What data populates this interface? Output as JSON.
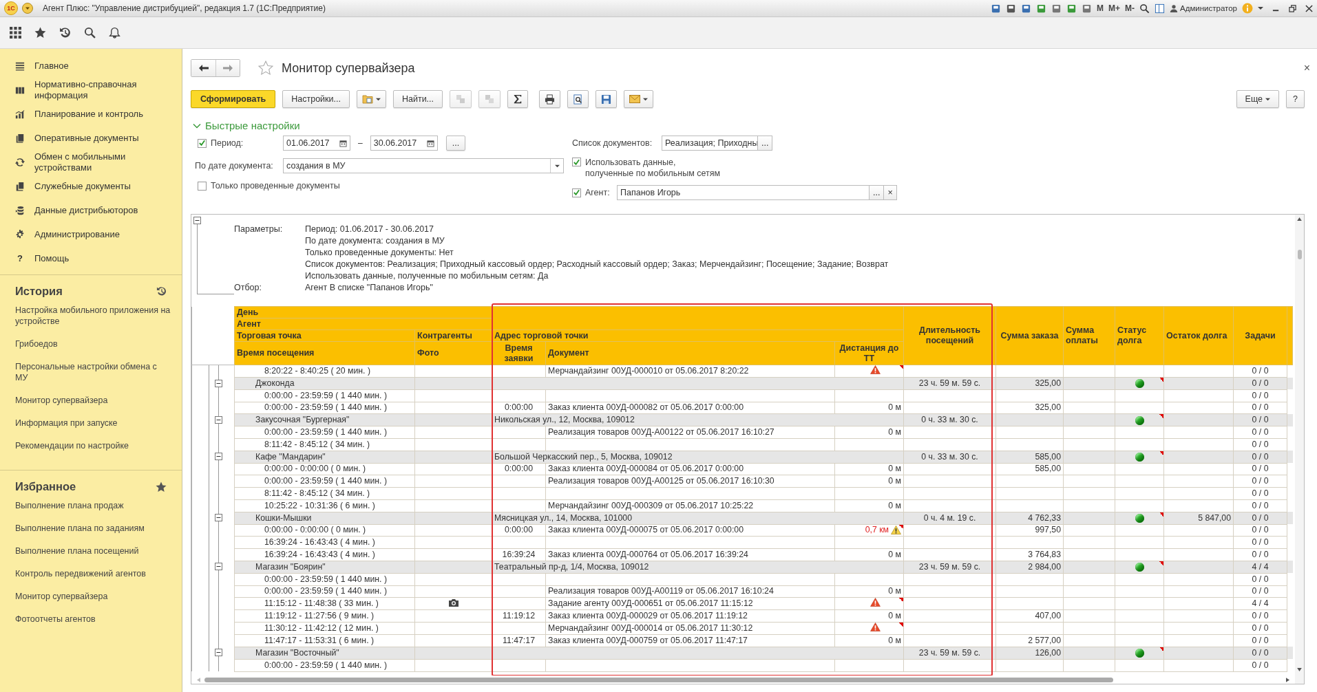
{
  "window": {
    "logo": "1С",
    "title": "Агент Плюс: \"Управление дистрибуцией\", редакция 1.7 (1С:Предприятие)",
    "memory_buttons": [
      "M",
      "M+",
      "M-"
    ],
    "user": "Администратор"
  },
  "sidebar": {
    "items": [
      {
        "label": "Главное"
      },
      {
        "label": "Нормативно-справочная информация"
      },
      {
        "label": "Планирование и контроль"
      },
      {
        "label": "Оперативные документы"
      },
      {
        "label": "Обмен с мобильными устройствами"
      },
      {
        "label": "Служебные документы"
      },
      {
        "label": "Данные дистрибьюторов"
      },
      {
        "label": "Администрирование"
      },
      {
        "label": "Помощь",
        "glyph": "?"
      }
    ],
    "history": {
      "title": "История",
      "items": [
        "Настройка мобильного приложения на устройстве",
        "Грибоедов",
        "Персональные настройки обмена с МУ",
        "Монитор супервайзера",
        "Информация при запуске",
        "Рекомендации по настройке"
      ]
    },
    "favorites": {
      "title": "Избранное",
      "items": [
        "Выполнение плана продаж",
        "Выполнение плана по заданиям",
        "Выполнение плана посещений",
        "Контроль передвижений агентов",
        "Монитор супервайзера",
        "Фотоотчеты агентов"
      ]
    }
  },
  "page": {
    "title": "Монитор супервайзера",
    "close": "×"
  },
  "toolbar": {
    "generate": "Сформировать",
    "settings": "Настройки...",
    "find": "Найти...",
    "more": "Еще",
    "help": "?"
  },
  "quick_settings": {
    "title": "Быстрые настройки",
    "expanded": true,
    "period": {
      "label": "Период:",
      "checked": true,
      "from": "01.06.2017",
      "dash": "–",
      "to": "30.06.2017",
      "more": "..."
    },
    "by_date": {
      "label": "По дате документа:",
      "value": "создания в МУ"
    },
    "posted_only": {
      "label": "Только проведенные документы",
      "checked": false
    },
    "doc_list": {
      "label": "Список документов:",
      "value": "Реализация; Приходны",
      "more": "..."
    },
    "mobile": {
      "label_lines": [
        "Использовать данные,",
        "полученные по мобильным сетям"
      ],
      "checked": true
    },
    "agent": {
      "label": "Агент:",
      "checked": true,
      "value": "Папанов Игорь",
      "more": "...",
      "clear": "×"
    }
  },
  "report": {
    "expanded": true,
    "params": {
      "label": "Параметры:",
      "lines": [
        "Период: 01.06.2017 - 30.06.2017",
        "По дате документа: создания в МУ",
        "Только проведенные документы: Нет",
        "Список документов: Реализация; Приходный кассовый ордер; Расходный кассовый ордер; Заказ; Мерчендайзинг; Посещение; Задание; Возврат",
        "Использовать данные, полученные по мобильным сетям: Да"
      ]
    },
    "filter": {
      "label": "Отбор:",
      "value": "Агент В списке \"Папанов Игорь\""
    },
    "header": {
      "day": "День",
      "agent": "Агент",
      "outlet": "Торговая точка",
      "counterparty": "Контрагенты",
      "address": "Адрес торговой точки",
      "visit_time": "Время посещения",
      "photo": "Фото",
      "order_time": "Время заявки",
      "document": "Документ",
      "distance": "Дистанция до ТТ",
      "duration": "Длительность посещений",
      "order_sum": "Сумма заказа",
      "payment_sum": "Сумма оплаты",
      "debt_status": "Статус долга",
      "debt_rest": "Остаток долга",
      "tasks": "Задачи"
    },
    "rows": [
      {
        "kind": "visit",
        "text": "8:20:22 - 8:40:25 ( 20 мин. )",
        "document": "Мерчандайзинг 00УД-000010 от 05.06.2017 8:20:22",
        "error": true,
        "tasks": "0 / 0"
      },
      {
        "kind": "group",
        "expanded": true,
        "text": "Джоконда",
        "duration": "23 ч. 59 м. 59 с.",
        "order_sum": "325,00",
        "debt_ok": true,
        "tasks": "0 / 0"
      },
      {
        "kind": "visit",
        "text": "0:00:00 - 23:59:59 ( 1 440 мин. )",
        "tasks": "0 / 0"
      },
      {
        "kind": "visit",
        "text": "0:00:00 - 23:59:59 ( 1 440 мин. )",
        "order_time": "0:00:00",
        "document": "Заказ клиента 00УД-000082 от 05.06.2017 0:00:00",
        "distance": "0 м",
        "order_sum": "325,00",
        "tasks": "0 / 0"
      },
      {
        "kind": "group",
        "expanded": true,
        "text": "Закусочная \"Бургерная\"",
        "address": "Никольская ул., 12, Москва, 109012",
        "duration": "0 ч. 33 м. 30 с.",
        "debt_ok": true,
        "tasks": "0 / 0"
      },
      {
        "kind": "visit",
        "text": "0:00:00 - 23:59:59 ( 1 440 мин. )",
        "document": "Реализация товаров 00УД-А00122 от 05.06.2017 16:10:27",
        "distance": "0 м",
        "tasks": "0 / 0"
      },
      {
        "kind": "visit",
        "text": "8:11:42 - 8:45:12 ( 34 мин. )",
        "tasks": "0 / 0"
      },
      {
        "kind": "group",
        "expanded": true,
        "text": "Кафе \"Мандарин\"",
        "address": "Большой Черкасский пер., 5, Москва, 109012",
        "duration": "0 ч. 33 м. 30 с.",
        "order_sum": "585,00",
        "debt_ok": true,
        "tasks": "0 / 0"
      },
      {
        "kind": "visit",
        "text": "0:00:00 - 0:00:00 ( 0 мин. )",
        "order_time": "0:00:00",
        "document": "Заказ клиента 00УД-000084 от 05.06.2017 0:00:00",
        "distance": "0 м",
        "order_sum": "585,00",
        "tasks": "0 / 0"
      },
      {
        "kind": "visit",
        "text": "0:00:00 - 23:59:59 ( 1 440 мин. )",
        "document": "Реализация товаров 00УД-А00125 от 05.06.2017 16:10:30",
        "distance": "0 м",
        "tasks": "0 / 0"
      },
      {
        "kind": "visit",
        "text": "8:11:42 - 8:45:12 ( 34 мин. )",
        "tasks": "0 / 0"
      },
      {
        "kind": "visit",
        "text": "10:25:22 - 10:31:36 ( 6 мин. )",
        "document": "Мерчандайзинг 00УД-000309 от 05.06.2017 10:25:22",
        "distance": "0 м",
        "tasks": "0 / 0"
      },
      {
        "kind": "group",
        "expanded": true,
        "text": "Кошки-Мышки",
        "address": "Мясницкая ул., 14, Москва, 101000",
        "duration": "0 ч. 4 м. 19 с.",
        "order_sum": "4 762,33",
        "debt_ok": true,
        "debt_rest": "5 847,00",
        "tasks": "0 / 0"
      },
      {
        "kind": "visit",
        "text": "0:00:00 - 0:00:00 ( 0 мин. )",
        "order_time": "0:00:00",
        "document": "Заказ клиента 00УД-000075 от 05.06.2017 0:00:00",
        "distance": "0,7 км",
        "warning": true,
        "order_sum": "997,50",
        "tasks": "0 / 0"
      },
      {
        "kind": "visit",
        "text": "16:39:24 - 16:43:43 ( 4 мин. )",
        "tasks": "0 / 0"
      },
      {
        "kind": "visit",
        "text": "16:39:24 - 16:43:43 ( 4 мин. )",
        "order_time": "16:39:24",
        "document": "Заказ клиента 00УД-000764 от 05.06.2017 16:39:24",
        "distance": "0 м",
        "order_sum": "3 764,83",
        "tasks": "0 / 0"
      },
      {
        "kind": "group",
        "expanded": true,
        "text": "Магазин \"Боярин\"",
        "address": "Театральный пр-д, 1/4, Москва, 109012",
        "duration": "23 ч. 59 м. 59 с.",
        "order_sum": "2 984,00",
        "debt_ok": true,
        "tasks": "4 / 4"
      },
      {
        "kind": "visit",
        "text": "0:00:00 - 23:59:59 ( 1 440 мин. )",
        "tasks": "0 / 0"
      },
      {
        "kind": "visit",
        "text": "0:00:00 - 23:59:59 ( 1 440 мин. )",
        "document": "Реализация товаров 00УД-А00119 от 05.06.2017 16:10:24",
        "distance": "0 м",
        "tasks": "0 / 0"
      },
      {
        "kind": "visit",
        "text": "11:15:12 - 11:48:38 ( 33 мин. )",
        "photo": true,
        "document": "Задание агенту 00УД-000651 от 05.06.2017 11:15:12",
        "error": true,
        "tasks": "4 / 4"
      },
      {
        "kind": "visit",
        "text": "11:19:12 - 11:27:56 ( 9 мин. )",
        "order_time": "11:19:12",
        "document": "Заказ клиента 00УД-000029 от 05.06.2017 11:19:12",
        "distance": "0 м",
        "order_sum": "407,00",
        "tasks": "0 / 0"
      },
      {
        "kind": "visit",
        "text": "11:30:12 - 11:42:12 ( 12 мин. )",
        "document": "Мерчандайзинг 00УД-000014 от 05.06.2017 11:30:12",
        "error": true,
        "tasks": "0 / 0"
      },
      {
        "kind": "visit",
        "text": "11:47:17 - 11:53:31 ( 6 мин. )",
        "order_time": "11:47:17",
        "document": "Заказ клиента 00УД-000759 от 05.06.2017 11:47:17",
        "distance": "0 м",
        "order_sum": "2 577,00",
        "tasks": "0 / 0"
      },
      {
        "kind": "group",
        "expanded": true,
        "text": "Магазин \"Восточный\"",
        "duration": "23 ч. 59 м. 59 с.",
        "order_sum": "126,00",
        "debt_ok": true,
        "tasks": "0 / 0"
      },
      {
        "kind": "visit",
        "text": "0:00:00 - 23:59:59 ( 1 440 мин. )",
        "tasks": "0 / 0"
      }
    ]
  }
}
